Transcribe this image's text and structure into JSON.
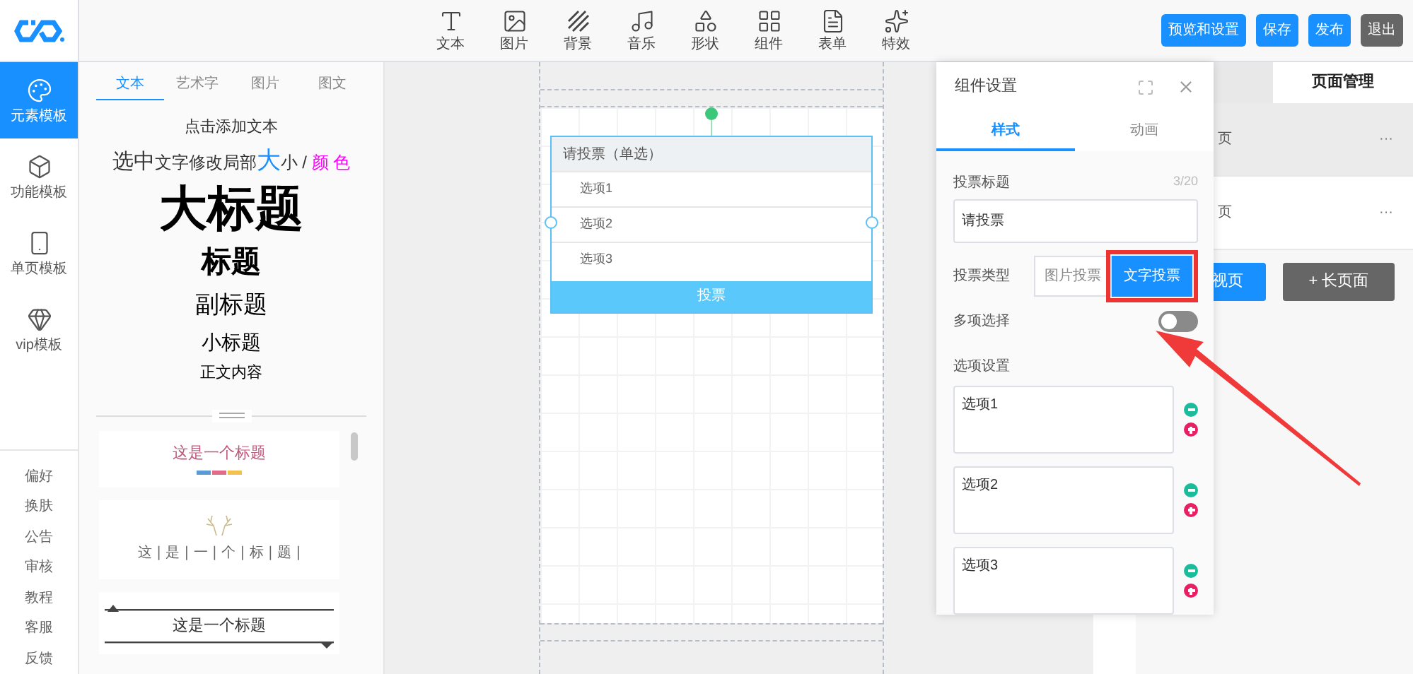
{
  "toolbar": [
    {
      "label": "文本",
      "kind": "text"
    },
    {
      "label": "图片",
      "kind": "image"
    },
    {
      "label": "背景",
      "kind": "background"
    },
    {
      "label": "音乐",
      "kind": "music"
    },
    {
      "label": "形状",
      "kind": "shape"
    },
    {
      "label": "组件",
      "kind": "widget"
    },
    {
      "label": "表单",
      "kind": "form"
    },
    {
      "label": "特效",
      "kind": "effect"
    }
  ],
  "actions": [
    {
      "label": "预览和设置",
      "kind": "primary"
    },
    {
      "label": "保存",
      "kind": "primary"
    },
    {
      "label": "发布",
      "kind": "primary"
    },
    {
      "label": "退出",
      "kind": "secondary"
    }
  ],
  "nav": [
    {
      "label": "元素模板",
      "kind": "palette",
      "selected": true
    },
    {
      "label": "功能模板",
      "kind": "cube",
      "selected": false
    },
    {
      "label": "单页模板",
      "kind": "page",
      "selected": false
    },
    {
      "label": "vip模板",
      "kind": "vip",
      "selected": false
    }
  ],
  "nav_bottom": [
    "偏好",
    "换肤",
    "公告",
    "审核",
    "教程",
    "客服",
    "反馈"
  ],
  "panel_tabs": [
    {
      "label": "文本",
      "selected": true
    },
    {
      "label": "艺术字",
      "selected": false
    },
    {
      "label": "图片",
      "selected": false
    },
    {
      "label": "图文",
      "selected": false
    }
  ],
  "add_text": "点击添加文本",
  "hint": [
    {
      "text": "选中",
      "kind": "large"
    },
    {
      "text": "文字修改局部",
      "kind": "normal"
    },
    {
      "text": "大",
      "kind": "accent"
    },
    {
      "text": "小 / ",
      "kind": "normal"
    },
    {
      "text": "颜 色",
      "kind": "color"
    }
  ],
  "headings": [
    {
      "text": "大标题",
      "kind": "h1"
    },
    {
      "text": "标题",
      "kind": "h2"
    },
    {
      "text": "副标题",
      "kind": "h3"
    },
    {
      "text": "小标题",
      "kind": "h4"
    },
    {
      "text": "正文内容",
      "kind": "body"
    }
  ],
  "templates": [
    {
      "text": "这是一个标题",
      "kind": "color-bar"
    },
    {
      "text": "这 | 是 | 一 | 个 | 标 | 题 |",
      "kind": "antler"
    },
    {
      "text": "这是一个标题",
      "kind": "lines"
    }
  ],
  "vote": {
    "title": "请投票（单选）",
    "options": [
      "选项1",
      "选项2",
      "选项3"
    ],
    "button": "投票"
  },
  "settings": {
    "title": "组件设置",
    "tabs": [
      {
        "label": "样式",
        "selected": true
      },
      {
        "label": "动画",
        "selected": false
      }
    ],
    "title_label": "投票标题",
    "counter": "3/20",
    "title_value": "请投票",
    "type_label": "投票类型",
    "types": [
      {
        "label": "图片投票",
        "selected": false
      },
      {
        "label": "文字投票",
        "selected": true
      }
    ],
    "multi_label": "多项选择",
    "multi_on": false,
    "options_label": "选项设置",
    "options": [
      "选项1",
      "选项2",
      "选项3"
    ]
  },
  "pages": {
    "tab": "页面管理",
    "rows": [
      {
        "label": "页",
        "selected": true,
        "more": "···"
      },
      {
        "label": "页",
        "selected": false,
        "more": "···"
      }
    ],
    "buttons": [
      {
        "label": "视页",
        "kind": "primary"
      },
      {
        "label": "+ 长页面",
        "kind": "secondary"
      }
    ]
  }
}
